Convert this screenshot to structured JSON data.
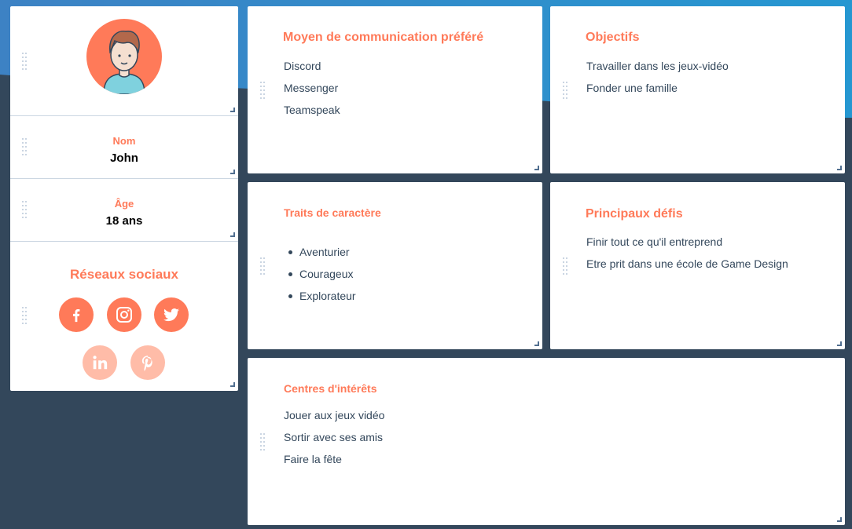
{
  "colors": {
    "accent": "#ff7a59",
    "accent_light": "#ffbca8",
    "background_dark": "#33475b",
    "background_blue_start": "#3d82c4",
    "background_blue_end": "#2597d1",
    "text": "#33475b"
  },
  "profile": {
    "avatar_icon": "avatar-boy-icon",
    "name_label": "Nom",
    "name_value": "John",
    "age_label": "Âge",
    "age_value": "18 ans"
  },
  "social": {
    "title": "Réseaux sociaux",
    "networks": [
      {
        "name": "facebook",
        "icon": "facebook-icon",
        "active": true
      },
      {
        "name": "instagram",
        "icon": "instagram-icon",
        "active": true
      },
      {
        "name": "twitter",
        "icon": "twitter-icon",
        "active": true
      },
      {
        "name": "linkedin",
        "icon": "linkedin-icon",
        "active": false
      },
      {
        "name": "pinterest",
        "icon": "pinterest-icon",
        "active": false
      }
    ]
  },
  "communication": {
    "title": "Moyen de communication préféré",
    "items": [
      "Discord",
      "Messenger",
      "Teamspeak"
    ]
  },
  "goals": {
    "title": "Objectifs",
    "items": [
      "Travailler dans les jeux-vidéo",
      "Fonder une famille"
    ]
  },
  "traits": {
    "title": "Traits de caractère",
    "items": [
      "Aventurier",
      "Courageux",
      "Explorateur"
    ]
  },
  "challenges": {
    "title": "Principaux défis",
    "items": [
      "Finir tout ce qu'il entreprend",
      "Etre prit dans une école de Game Design"
    ]
  },
  "interests": {
    "title": "Centres d'intérêts",
    "items": [
      "Jouer aux jeux vidéo",
      "Sortir avec ses amis",
      "Faire la fête"
    ]
  }
}
